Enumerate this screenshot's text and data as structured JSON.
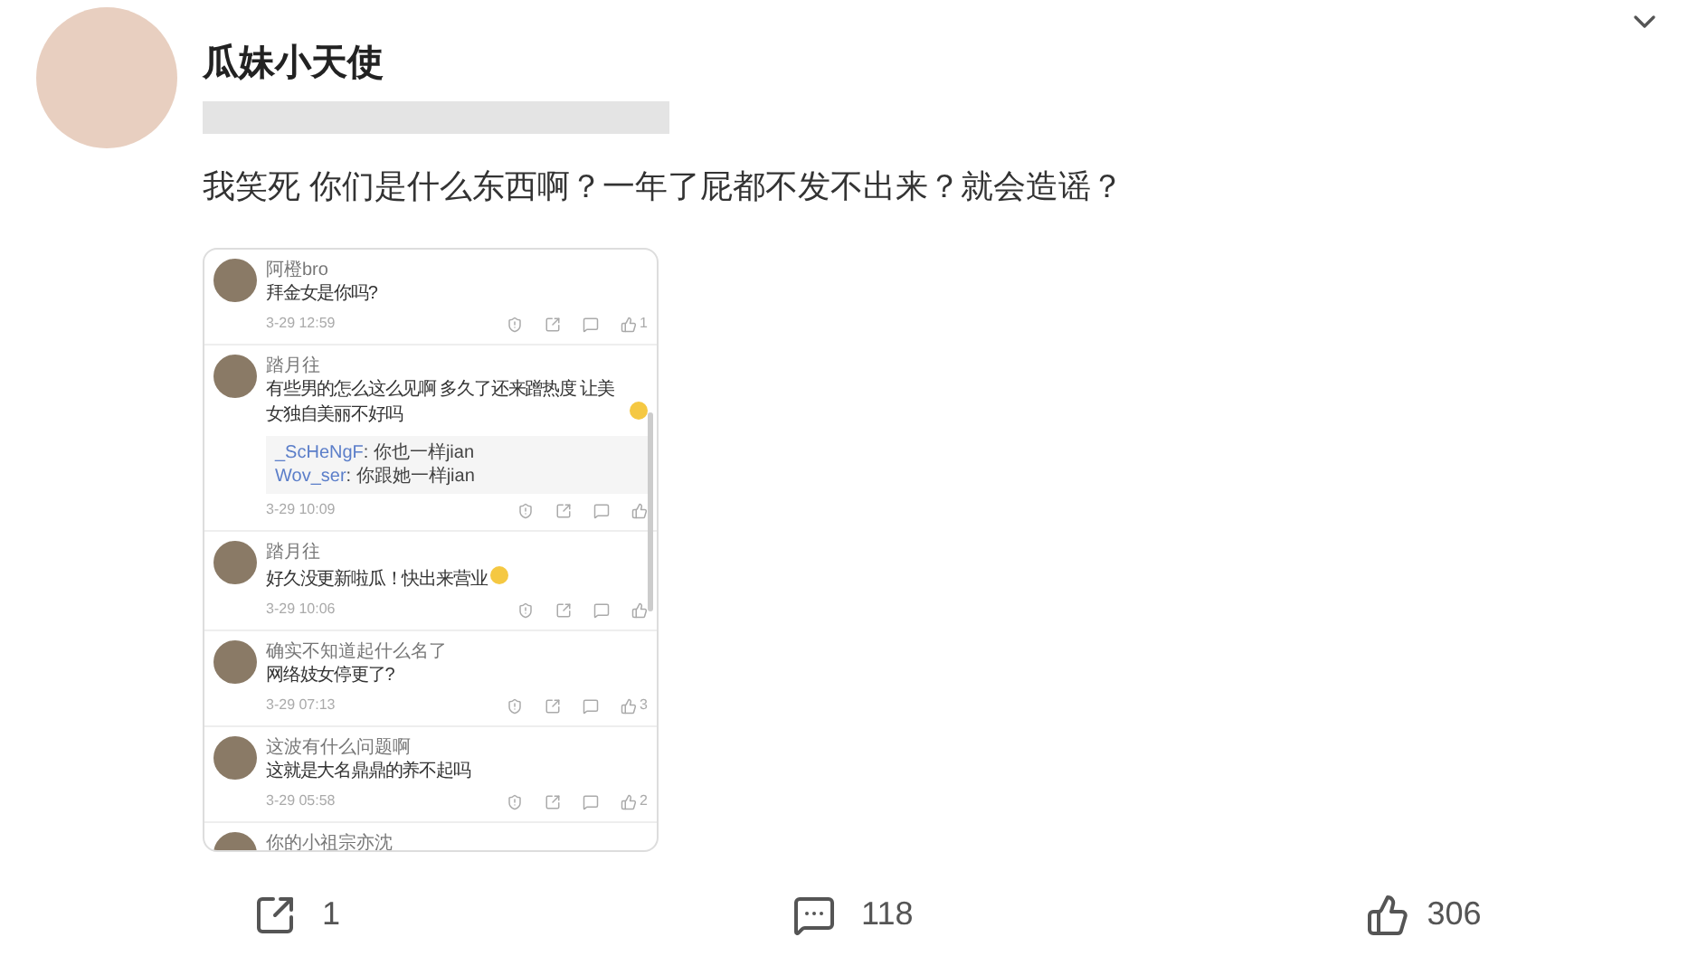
{
  "post": {
    "author": "瓜妹小天使",
    "text": "我笑死 你们是什么东西啊？一年了屁都不发不出来？就会造谣？"
  },
  "embedded_comments": [
    {
      "name": "阿橙bro",
      "text": "拜金女是你吗?",
      "time": "3-29 12:59",
      "likes": "1"
    },
    {
      "name": "踏月往",
      "text": "有些男的怎么这么见啊 多久了还来蹭热度 让美女独自美丽不好吗",
      "time": "3-29 10:09",
      "replies": [
        {
          "user": "_ScHeNgF",
          "text": ": 你也一样jian"
        },
        {
          "user": "Wov_ser",
          "text": ": 你跟她一样jian"
        }
      ]
    },
    {
      "name": "踏月往",
      "text": "好久没更新啦瓜！快出来营业",
      "time": "3-29 10:06"
    },
    {
      "name": "确实不知道起什么名了",
      "text": "网络妓女停更了?",
      "time": "3-29 07:13",
      "likes": "3"
    },
    {
      "name": "这波有什么问题啊",
      "text": "这就是大名鼎鼎的养不起吗",
      "time": "3-29 05:58",
      "likes": "2"
    },
    {
      "name": "你的小祖宗亦沈"
    }
  ],
  "actions": {
    "share": "1",
    "comments": "118",
    "likes": "306"
  }
}
